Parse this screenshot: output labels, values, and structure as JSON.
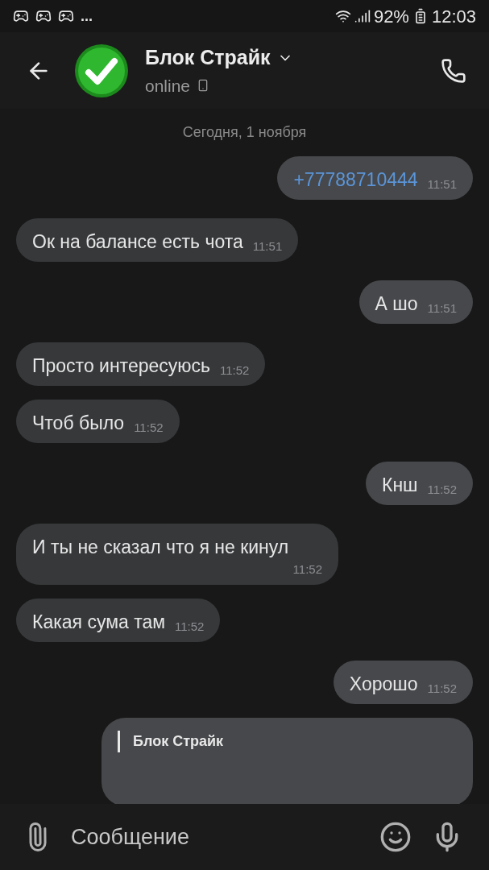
{
  "status_bar": {
    "overflow": "...",
    "battery": "92%",
    "time": "12:03"
  },
  "header": {
    "name": "Блок Страйк",
    "status": "online"
  },
  "date_divider": "Сегодня, 1 ноября",
  "messages": [
    {
      "kind": "phone",
      "outgoing": true,
      "text": "+77788710444",
      "time": "11:51"
    },
    {
      "kind": "text",
      "outgoing": false,
      "text": "Ок на балансе есть чота",
      "time": "11:51"
    },
    {
      "kind": "text",
      "outgoing": true,
      "text": "А шо",
      "time": "11:51"
    },
    {
      "kind": "text",
      "outgoing": false,
      "text": "Просто интересуюсь",
      "time": "11:52"
    },
    {
      "kind": "text",
      "outgoing": false,
      "text": "Чтоб было",
      "time": "11:52"
    },
    {
      "kind": "text",
      "outgoing": true,
      "text": "Кнш",
      "time": "11:52"
    },
    {
      "kind": "text",
      "outgoing": false,
      "text": "И ты не сказал что я не кинул",
      "time": "11:52"
    },
    {
      "kind": "text",
      "outgoing": false,
      "text": "Какая сума там",
      "time": "11:52"
    },
    {
      "kind": "text",
      "outgoing": true,
      "text": "Хорошо",
      "time": "11:52"
    },
    {
      "kind": "reply",
      "outgoing": true,
      "quote_author": "Блок Страйк"
    }
  ],
  "composer": {
    "placeholder": "Сообщение"
  }
}
